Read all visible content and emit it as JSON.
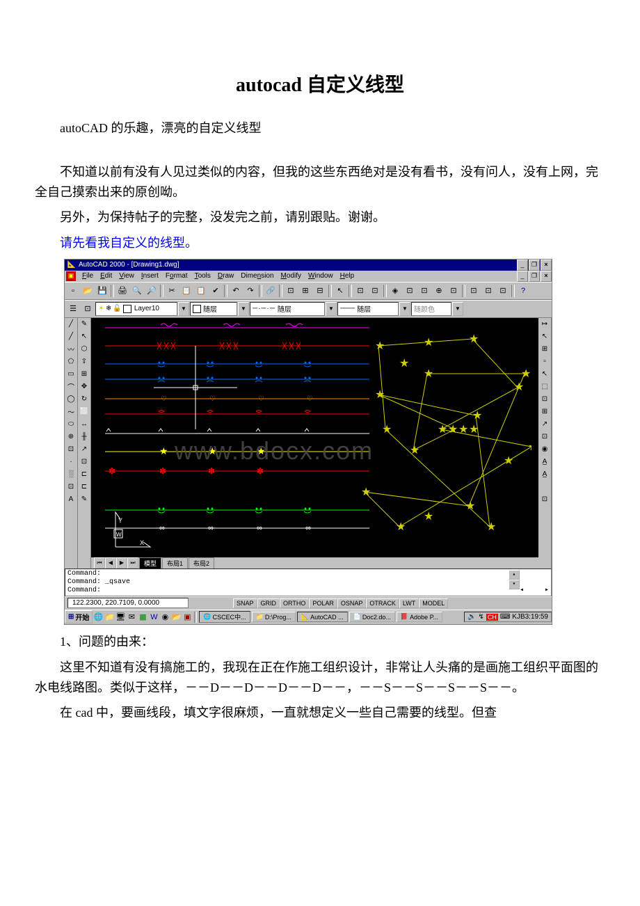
{
  "doc": {
    "title": "autocad 自定义线型",
    "p1": "autoCAD 的乐趣，漂亮的自定义线型",
    "p2": "不知道以前有没有人见过类似的内容，但我的这些东西绝对是没有看书，没有问人，没有上网，完全自己摸索出来的原创呦。",
    "p3": "另外，为保持帖子的完整，没发完之前，请别跟贴。谢谢。",
    "p4": "请先看我自定义的线型。",
    "p5": "1、问题的由来：",
    "p6": "这里不知道有没有搞施工的，我现在正在作施工组织设计，非常让人头痛的是画施工组织平面图的水电线路图。类似于这样，－－D－－D－－D－－D－－，－－S－－S－－S－－S－－。",
    "p7": "在 cad 中，要画线段，填文字很麻烦，一直就想定义一些自己需要的线型。但查"
  },
  "cad": {
    "titlebar": "AutoCAD 2000 - [Drawing1.dwg]",
    "menus": [
      "File",
      "Edit",
      "View",
      "Insert",
      "Format",
      "Tools",
      "Draw",
      "Dimension",
      "Modify",
      "Window",
      "Help"
    ],
    "layer_name": "Layer10",
    "bylayer_text": "随层",
    "bycolor_text": "随颜色",
    "layout": {
      "model": "模型",
      "l1": "布局1",
      "l2": "布局2"
    },
    "cmd": {
      "l1": "Command:",
      "l2": "Command:  _qsave",
      "l3": "Command:"
    },
    "status": {
      "coords": "122.2300, 220.7109, 0.0000",
      "toggles": [
        "SNAP",
        "GRID",
        "ORTHO",
        "POLAR",
        "OSNAP",
        "OTRACK",
        "LWT",
        "MODEL"
      ]
    },
    "taskbar": {
      "start": "开始",
      "tasks": [
        {
          "label": "CSCEC中...",
          "icon": "🌐"
        },
        {
          "label": "D:\\Prog...",
          "icon": "📁"
        },
        {
          "label": "AutoCAD ...",
          "icon": "📐"
        },
        {
          "label": "Doc2.do...",
          "icon": "📄"
        },
        {
          "label": "Adobe P...",
          "icon": "📕"
        }
      ],
      "ime": "CH",
      "clock": "KJB3:19:59"
    },
    "watermark": "www.bdocx.com"
  },
  "icons": {
    "draw_tools": [
      "╱",
      "╱",
      "〰",
      "⬭",
      "⌒",
      "⊙",
      "〜",
      "◯",
      "⊕",
      "░",
      "⊡",
      "A"
    ],
    "draw_tools2": [
      "✎",
      "↖",
      "⬡",
      "⇪",
      "⊞",
      "⊕",
      "▫",
      "⬜",
      "╱",
      "╫",
      "↗",
      "⊡",
      "⊏",
      "⊏",
      "✎"
    ],
    "right_tools": [
      "↦",
      "↖",
      "⊞",
      "▫",
      "↖",
      "⬚",
      "⊡",
      "⊞",
      "↗",
      "⊡",
      "◉",
      "A̲",
      "A̲",
      "",
      "⊡"
    ],
    "std_tb": [
      "📄",
      "📂",
      "💾",
      "|",
      "🖨",
      "🔍",
      "🔎",
      "|",
      "✂",
      "📋",
      "📋",
      "✔",
      "|",
      "↶",
      "↷",
      "|",
      "🔗",
      "|",
      "⊡",
      "⊞",
      "⊟",
      "|",
      "↖",
      "|",
      "⊡",
      "⊡",
      "|",
      "◈",
      "⊡",
      "⊡",
      "⊕",
      "⊡",
      "|",
      "⊡",
      "⊡",
      "⊡",
      "|",
      "?"
    ],
    "layer_tb_icons": [
      "☀",
      "💡",
      "❄",
      "🔒",
      "⬜"
    ]
  }
}
